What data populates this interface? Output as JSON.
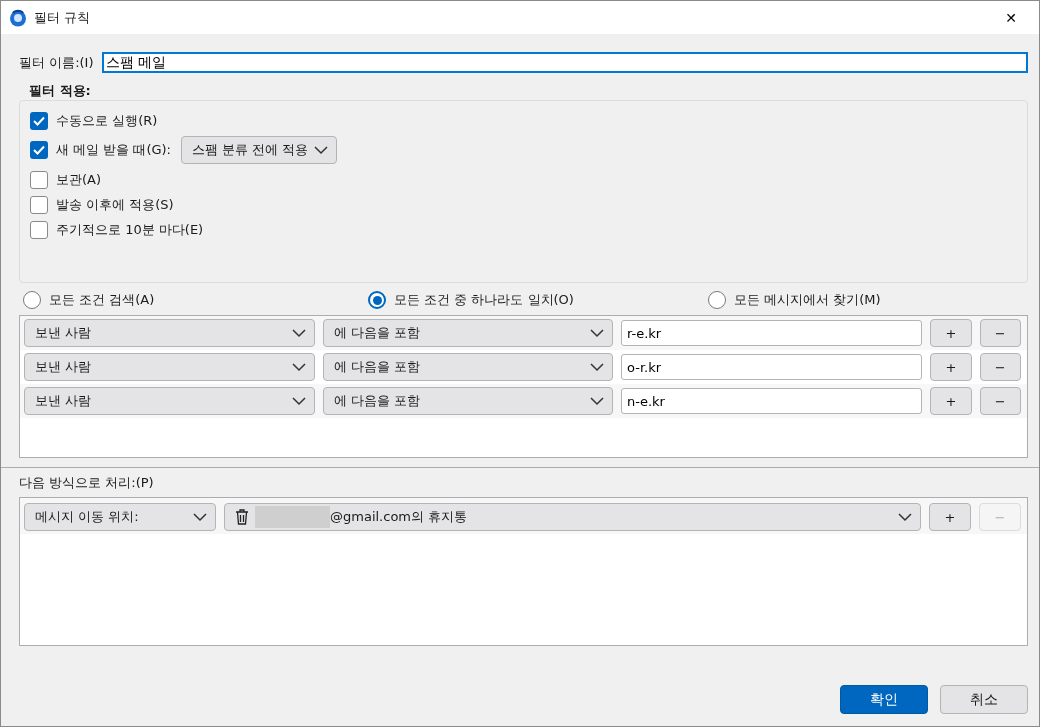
{
  "window": {
    "title": "필터 규칙",
    "close": "✕"
  },
  "filter_name": {
    "label": "필터 이름:(I)",
    "value": "스팸 메일"
  },
  "apply": {
    "label": "필터 적용:",
    "options": [
      {
        "label": "수동으로 실행(R)",
        "checked": true
      },
      {
        "label": "새 메일 받을 때(G):",
        "checked": true,
        "select": "스팸 분류 전에 적용"
      },
      {
        "label": "보관(A)",
        "checked": false
      },
      {
        "label": "발송 이후에 적용(S)",
        "checked": false
      },
      {
        "label": "주기적으로 10분 마다(E)",
        "checked": false
      }
    ]
  },
  "match": [
    {
      "label": "모든 조건 검색(A)",
      "selected": false
    },
    {
      "label": "모든 조건 중 하나라도 일치(O)",
      "selected": true
    },
    {
      "label": "모든 메시지에서 찾기(M)",
      "selected": false
    }
  ],
  "conditions": [
    {
      "field": "보낸 사람",
      "operator": "에 다음을 포함",
      "value": "r-e.kr",
      "add": "+",
      "remove": "−"
    },
    {
      "field": "보낸 사람",
      "operator": "에 다음을 포함",
      "value": "o-r.kr",
      "add": "+",
      "remove": "−"
    },
    {
      "field": "보낸 사람",
      "operator": "에 다음을 포함",
      "value": "n-e.kr",
      "add": "+",
      "remove": "−"
    }
  ],
  "actions_label": "다음 방식으로 처리:(P)",
  "actions": [
    {
      "action": "메시지 이동 위치:",
      "target": "@gmail.com의 휴지통",
      "add": "+",
      "remove": "−",
      "remove_disabled": true
    }
  ],
  "buttons": [
    {
      "label": "확인",
      "primary": true
    },
    {
      "label": "취소",
      "primary": false
    }
  ]
}
